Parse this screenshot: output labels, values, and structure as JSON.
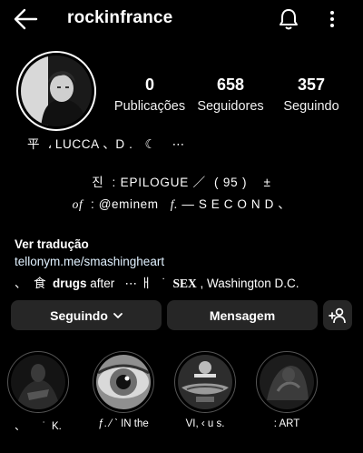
{
  "header": {
    "username": "rockinfrance",
    "back_icon": "arrow-left-icon",
    "bell_icon": "bell-icon",
    "menu_icon": "more-vertical-icon"
  },
  "stats": [
    {
      "value": "0",
      "label": "Publicações"
    },
    {
      "value": "658",
      "label": "Seguidores"
    },
    {
      "value": "357",
      "label": "Seguindo"
    }
  ],
  "bio": {
    "line1": "平  ، LUCCA 、D .   ☾    ⋯",
    "line2": "진  : EPILOGUE ／  ( 95 )    ±",
    "line3_prefix": "of",
    "line3_rest": "  : @eminem   ",
    "line3_f": "f.",
    "line3_end": " — S E C O N D 、",
    "translate": "Ver tradução",
    "link": "tellonym.me/smashingheart",
    "line4_a": "、  食  ",
    "line4_drugs": "drugs",
    "line4_b": " after   ⋯ ㅐ   ˙  ",
    "line4_sex": "SEX",
    "line4_c": " , Washington D.C."
  },
  "actions": {
    "follow_label": "Seguindo",
    "message_label": "Mensagem",
    "add_user_icon": "person-add-icon"
  },
  "highlights": [
    {
      "caption": "、      ˙  K."
    },
    {
      "caption": "ƒ. ⁄ ˋ IN the"
    },
    {
      "caption": "VI, ‹ u s."
    },
    {
      "caption": ": ART"
    }
  ],
  "colors": {
    "background": "#000000",
    "button": "#262626",
    "link": "#e0f1ff"
  }
}
